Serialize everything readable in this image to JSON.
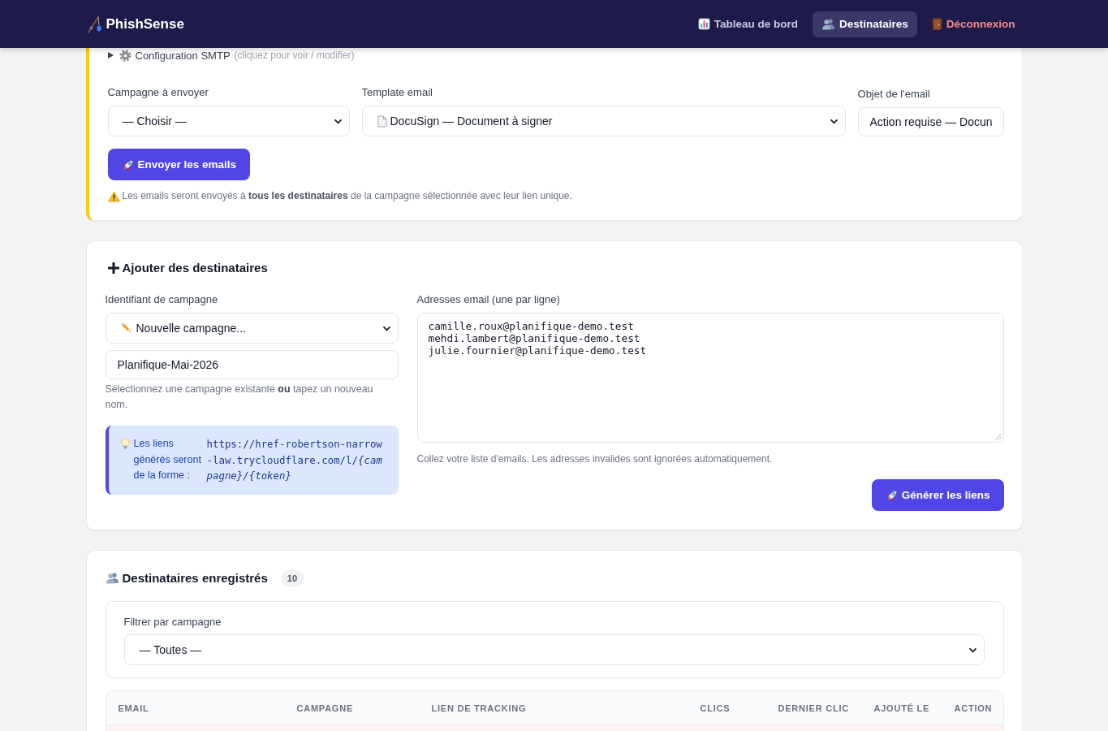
{
  "navbar": {
    "brand": "PhishSense",
    "links": [
      {
        "label": "Tableau de bord",
        "kind": "page",
        "selected": false
      },
      {
        "label": "Destinataires",
        "kind": "page",
        "selected": true
      },
      {
        "label": "Déconnexion",
        "kind": "logout",
        "selected": false
      }
    ]
  },
  "send_panel": {
    "smtp_config": {
      "label": "Configuration SMTP",
      "hint": "(cliquez pour voir / modifier)",
      "expanded": false
    },
    "fields": [
      {
        "kind": "select",
        "label": "Campagne à envoyer",
        "value": "— Choisir —"
      },
      {
        "kind": "select",
        "label": "Template email",
        "value": "DocuSign — Document à signer"
      },
      {
        "kind": "text",
        "label": "Objet de l'email",
        "value": "Action requise — Docun"
      }
    ],
    "button": "Envoyer les emails",
    "note": "Les emails seront envoyés à **tous les destinataires** de la campagne sélectionnée avec leur lien unique."
  },
  "add_panel": {
    "title": "Ajouter des destinataires",
    "campaign": {
      "label": "Identifiant de campagne",
      "fields": [
        {
          "kind": "select",
          "value": "Nouvelle campagne..."
        },
        {
          "kind": "text",
          "value": "Planifique-Mai-2026"
        }
      ],
      "help": "Sélectionnez une campagne existante **ou** tapez un nouveau nom."
    },
    "link_info": {
      "label": "Les liens générés seront de la forme :",
      "url": "https://href-robertson-narrow-law.trycloudflare.com/l/*{campagne}/{token}*"
    },
    "emails": {
      "label": "Adresses email (une par ligne)",
      "value": "camille.roux@planifique-demo.test\nmehdi.lambert@planifique-demo.test\njulie.fournier@planifique-demo.test",
      "help": "Collez votre liste d'emails. Les adresses invalides sont ignorées automatiquement."
    },
    "button": "Générer les liens"
  },
  "recipients_panel": {
    "title": "Destinataires enregistrés",
    "count": "10",
    "filter": {
      "label": "Filtrer par campagne",
      "field": {
        "kind": "select",
        "value": "— Toutes —"
      }
    },
    "table": {
      "columns": [
        "EMAIL",
        "CAMPAGNE",
        "LIEN DE TRACKING",
        "CLICS",
        "DERNIER CLIC",
        "AJOUTÉ LE",
        "ACTION"
      ],
      "rows": [
        {
          "highlighted": true
        }
      ]
    }
  }
}
